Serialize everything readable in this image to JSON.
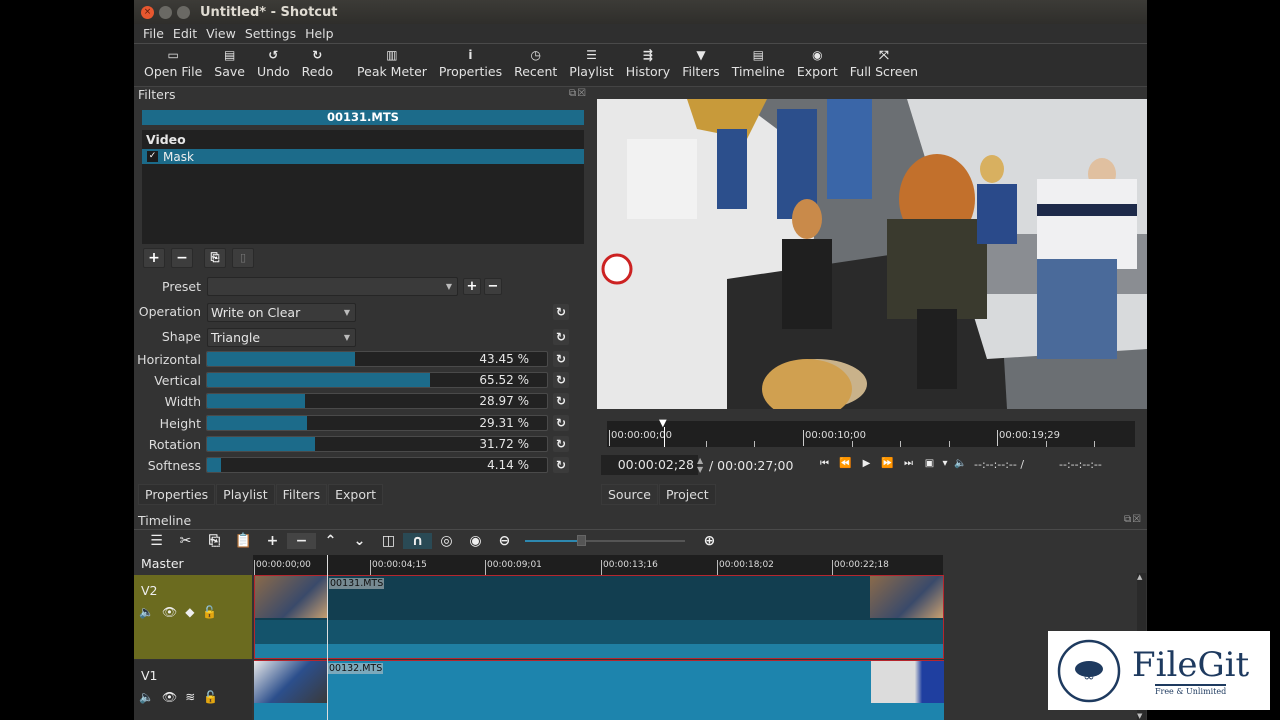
{
  "window": {
    "title": "Untitled* - Shotcut",
    "controls": [
      "close",
      "minimize",
      "maximize"
    ]
  },
  "menu": [
    "File",
    "Edit",
    "View",
    "Settings",
    "Help"
  ],
  "toolbar": [
    {
      "label": "Open File",
      "icon": "open-file-icon",
      "glyph": "▭"
    },
    {
      "label": "Save",
      "icon": "save-icon",
      "glyph": "▤"
    },
    {
      "label": "Undo",
      "icon": "undo-icon",
      "glyph": "↺"
    },
    {
      "label": "Redo",
      "icon": "redo-icon",
      "glyph": "↻"
    },
    {
      "label": "Peak Meter",
      "icon": "peak-meter-icon",
      "glyph": "▥"
    },
    {
      "label": "Properties",
      "icon": "info-icon",
      "glyph": "i"
    },
    {
      "label": "Recent",
      "icon": "clock-icon",
      "glyph": "◷"
    },
    {
      "label": "Playlist",
      "icon": "list-icon",
      "glyph": "☰"
    },
    {
      "label": "History",
      "icon": "history-icon",
      "glyph": "⇶"
    },
    {
      "label": "Filters",
      "icon": "funnel-icon",
      "glyph": "▼"
    },
    {
      "label": "Timeline",
      "icon": "timeline-icon",
      "glyph": "▤"
    },
    {
      "label": "Export",
      "icon": "export-disc-icon",
      "glyph": "◉"
    },
    {
      "label": "Full Screen",
      "icon": "fullscreen-icon",
      "glyph": "⤧"
    }
  ],
  "filters_panel": {
    "title": "Filters",
    "clip_name": "00131.MTS",
    "group": "Video",
    "filters": [
      {
        "name": "Mask",
        "enabled": true,
        "check": "✓"
      }
    ],
    "preset_label": "Preset",
    "preset_value": "",
    "operation_label": "Operation",
    "operation_value": "Write on Clear",
    "shape_label": "Shape",
    "shape_value": "Triangle",
    "params": [
      {
        "label": "Horizontal",
        "value": 43.45,
        "display": "43.45 %"
      },
      {
        "label": "Vertical",
        "value": 65.52,
        "display": "65.52 %"
      },
      {
        "label": "Width",
        "value": 28.97,
        "display": "28.97 %"
      },
      {
        "label": "Height",
        "value": 29.31,
        "display": "29.31 %"
      },
      {
        "label": "Rotation",
        "value": 31.72,
        "display": "31.72 %"
      },
      {
        "label": "Softness",
        "value": 4.14,
        "display": "4.14 %"
      }
    ],
    "tabs": [
      "Properties",
      "Playlist",
      "Filters",
      "Export"
    ],
    "active_tab": "Filters"
  },
  "player": {
    "ruler_labels": [
      "00:00:00;00",
      "00:00:10;00",
      "00:00:19;29"
    ],
    "current_timecode": "00:00:02;28",
    "duration": "/ 00:00:27;00",
    "in_point": "--:--:--:-- /",
    "out_point": "--:--:--:--",
    "tabs": [
      "Source",
      "Project"
    ],
    "active_tab": "Source"
  },
  "timeline": {
    "title": "Timeline",
    "master_label": "Master",
    "ruler_labels": [
      "00:00:00;00",
      "00:00:04;15",
      "00:00:09;01",
      "00:00:13;16",
      "00:00:18;02",
      "00:00:22;18"
    ],
    "zoom_level": 0.35,
    "tracks": [
      {
        "name": "V2",
        "clip": "00131.MTS",
        "color": "#6b6b1f"
      },
      {
        "name": "V1",
        "clip": "00132.MTS",
        "color": "#2f2f2f"
      }
    ]
  },
  "watermark": {
    "brand": "FileGit",
    "tagline": "Free & Unlimited"
  },
  "colors": {
    "accent": "#1c6b8a",
    "selected_track": "#6b6b1f",
    "clip_border": "#b5262e"
  }
}
